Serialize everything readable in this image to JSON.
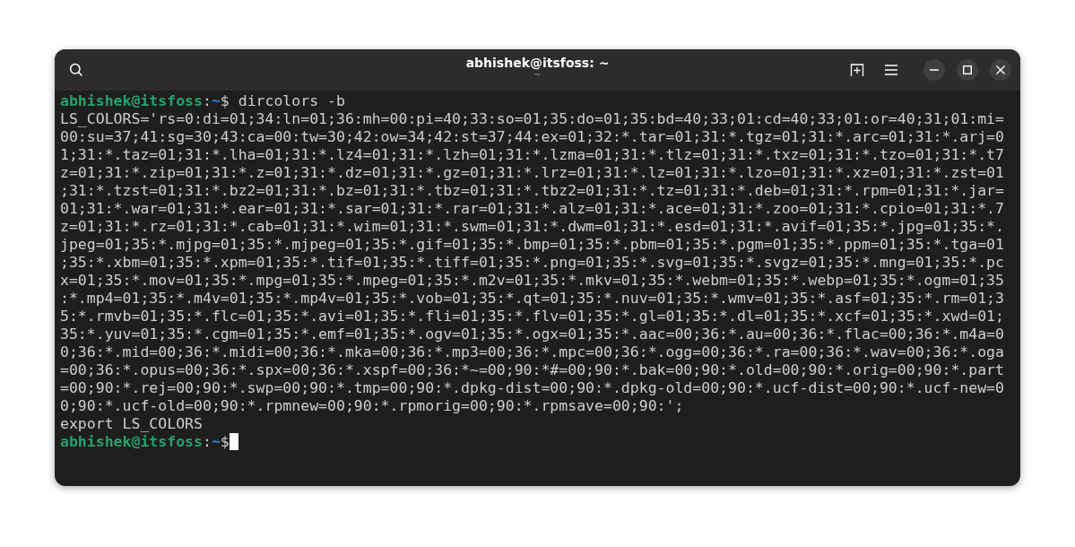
{
  "window": {
    "title": "abhishek@itsfoss: ~",
    "subtitle": "~"
  },
  "terminal": {
    "lines": [
      {
        "kind": "prompt",
        "user": "abhishek@itsfoss",
        "separator": ":",
        "path": "~",
        "symbol": "$",
        "command": " dircolors -b"
      },
      {
        "kind": "output",
        "text": "LS_COLORS='rs=0:di=01;34:ln=01;36:mh=00:pi=40;33:so=01;35:do=01;35:bd=40;33;01:cd=40;33;01:or=40;31;01:mi="
      },
      {
        "kind": "output",
        "text": "00:su=37;41:sg=30;43:ca=00:tw=30;42:ow=34;42:st=37;44:ex=01;32:*.tar=01;31:*.tgz=01;31:*.arc=01;31:*.arj=0"
      },
      {
        "kind": "output",
        "text": "1;31:*.taz=01;31:*.lha=01;31:*.lz4=01;31:*.lzh=01;31:*.lzma=01;31:*.tlz=01;31:*.txz=01;31:*.tzo=01;31:*.t7"
      },
      {
        "kind": "output",
        "text": "z=01;31:*.zip=01;31:*.z=01;31:*.dz=01;31:*.gz=01;31:*.lrz=01;31:*.lz=01;31:*.lzo=01;31:*.xz=01;31:*.zst=01"
      },
      {
        "kind": "output",
        "text": ";31:*.tzst=01;31:*.bz2=01;31:*.bz=01;31:*.tbz=01;31:*.tbz2=01;31:*.tz=01;31:*.deb=01;31:*.rpm=01;31:*.jar="
      },
      {
        "kind": "output",
        "text": "01;31:*.war=01;31:*.ear=01;31:*.sar=01;31:*.rar=01;31:*.alz=01;31:*.ace=01;31:*.zoo=01;31:*.cpio=01;31:*.7"
      },
      {
        "kind": "output",
        "text": "z=01;31:*.rz=01;31:*.cab=01;31:*.wim=01;31:*.swm=01;31:*.dwm=01;31:*.esd=01;31:*.avif=01;35:*.jpg=01;35:*."
      },
      {
        "kind": "output",
        "text": "jpeg=01;35:*.mjpg=01;35:*.mjpeg=01;35:*.gif=01;35:*.bmp=01;35:*.pbm=01;35:*.pgm=01;35:*.ppm=01;35:*.tga=01"
      },
      {
        "kind": "output",
        "text": ";35:*.xbm=01;35:*.xpm=01;35:*.tif=01;35:*.tiff=01;35:*.png=01;35:*.svg=01;35:*.svgz=01;35:*.mng=01;35:*.pc"
      },
      {
        "kind": "output",
        "text": "x=01;35:*.mov=01;35:*.mpg=01;35:*.mpeg=01;35:*.m2v=01;35:*.mkv=01;35:*.webm=01;35:*.webp=01;35:*.ogm=01;35"
      },
      {
        "kind": "output",
        "text": ":*.mp4=01;35:*.m4v=01;35:*.mp4v=01;35:*.vob=01;35:*.qt=01;35:*.nuv=01;35:*.wmv=01;35:*.asf=01;35:*.rm=01;3"
      },
      {
        "kind": "output",
        "text": "5:*.rmvb=01;35:*.flc=01;35:*.avi=01;35:*.fli=01;35:*.flv=01;35:*.gl=01;35:*.dl=01;35:*.xcf=01;35:*.xwd=01;"
      },
      {
        "kind": "output",
        "text": "35:*.yuv=01;35:*.cgm=01;35:*.emf=01;35:*.ogv=01;35:*.ogx=01;35:*.aac=00;36:*.au=00;36:*.flac=00;36:*.m4a=0"
      },
      {
        "kind": "output",
        "text": "0;36:*.mid=00;36:*.midi=00;36:*.mka=00;36:*.mp3=00;36:*.mpc=00;36:*.ogg=00;36:*.ra=00;36:*.wav=00;36:*.oga"
      },
      {
        "kind": "output",
        "text": "=00;36:*.opus=00;36:*.spx=00;36:*.xspf=00;36:*~=00;90:*#=00;90:*.bak=00;90:*.old=00;90:*.orig=00;90:*.part"
      },
      {
        "kind": "output",
        "text": "=00;90:*.rej=00;90:*.swp=00;90:*.tmp=00;90:*.dpkg-dist=00;90:*.dpkg-old=00;90:*.ucf-dist=00;90:*.ucf-new=0"
      },
      {
        "kind": "output",
        "text": "0;90:*.ucf-old=00;90:*.rpmnew=00;90:*.rpmorig=00;90:*.rpmsave=00;90:';"
      },
      {
        "kind": "output",
        "text": "export LS_COLORS"
      },
      {
        "kind": "prompt",
        "user": "abhishek@itsfoss",
        "separator": ":",
        "path": "~",
        "symbol": "$",
        "cursor": true
      }
    ]
  }
}
